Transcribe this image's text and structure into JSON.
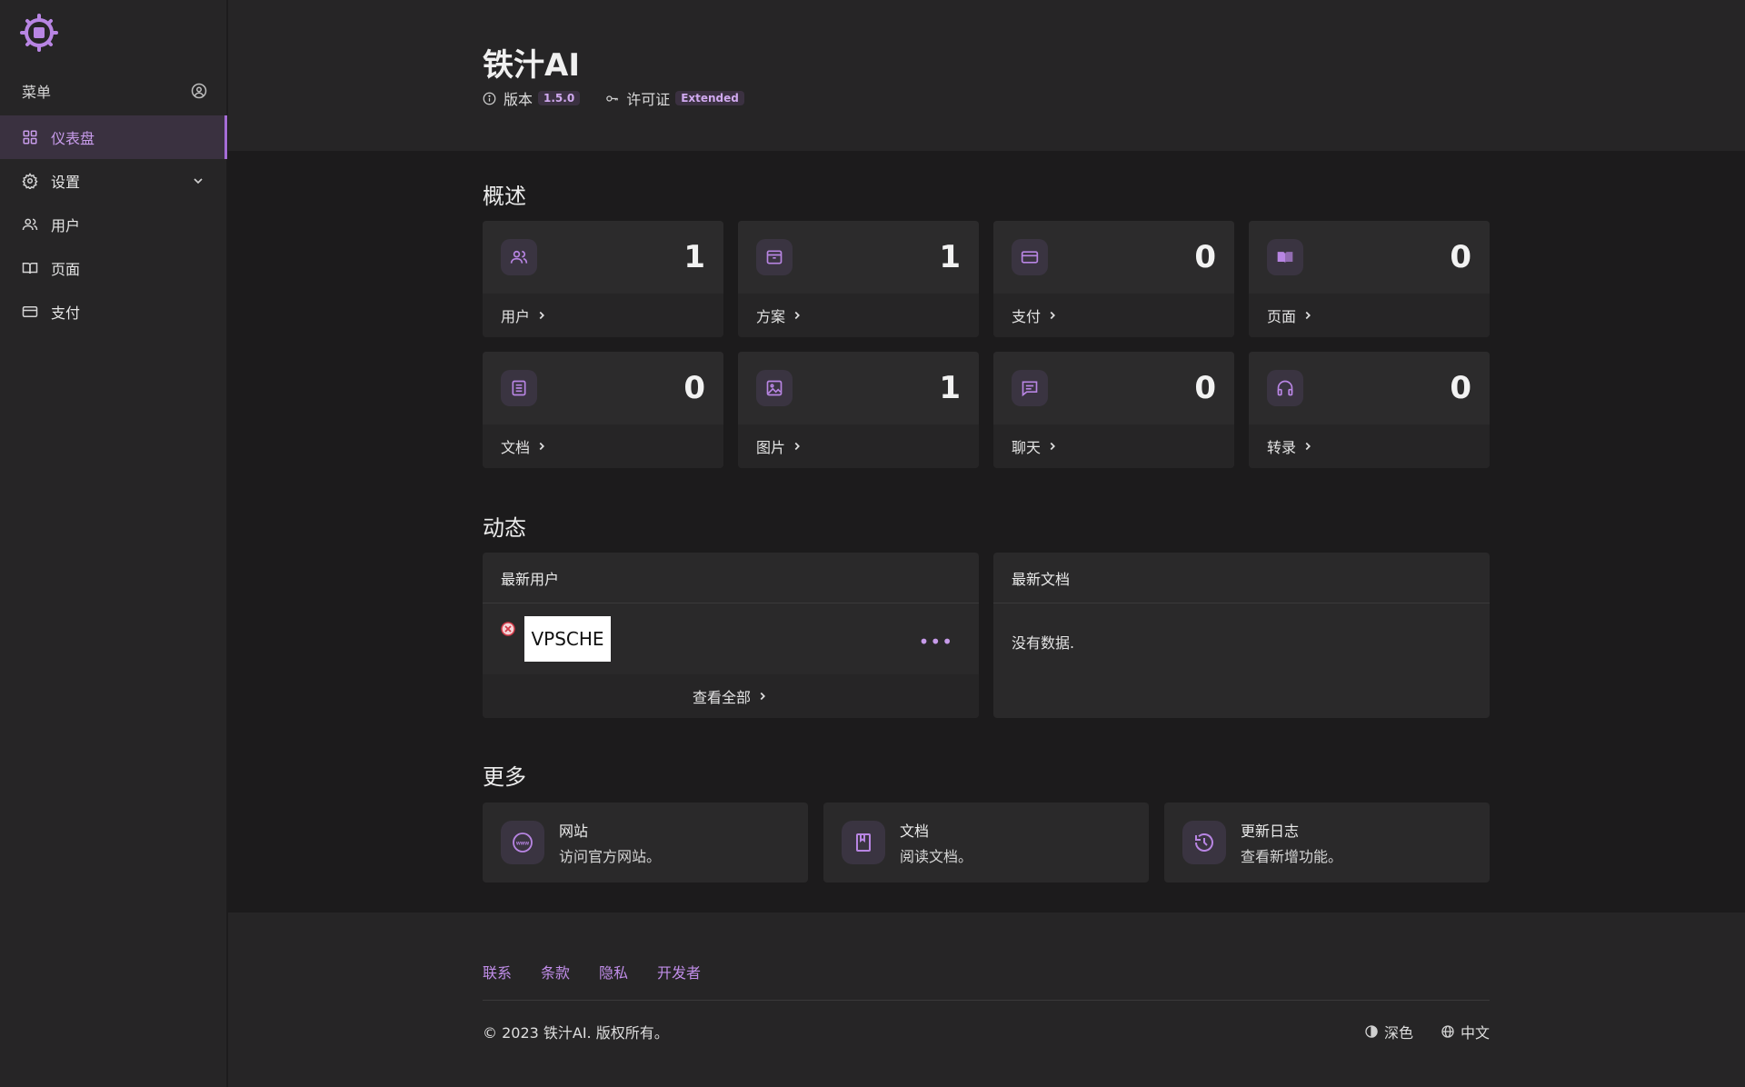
{
  "sidebar": {
    "menu_label": "菜单",
    "items": [
      {
        "label": "仪表盘",
        "icon": "grid-icon"
      },
      {
        "label": "设置",
        "icon": "gear-icon"
      },
      {
        "label": "用户",
        "icon": "users-icon"
      },
      {
        "label": "页面",
        "icon": "book-icon"
      },
      {
        "label": "支付",
        "icon": "card-icon"
      }
    ]
  },
  "header": {
    "title": "铁汁AI",
    "version_label": "版本",
    "version": "1.5.0",
    "license_label": "许可证",
    "license": "Extended"
  },
  "overview": {
    "title": "概述",
    "cards": [
      {
        "label": "用户",
        "value": "1"
      },
      {
        "label": "方案",
        "value": "1"
      },
      {
        "label": "支付",
        "value": "0"
      },
      {
        "label": "页面",
        "value": "0"
      },
      {
        "label": "文档",
        "value": "0"
      },
      {
        "label": "图片",
        "value": "1"
      },
      {
        "label": "聊天",
        "value": "0"
      },
      {
        "label": "转录",
        "value": "0"
      }
    ]
  },
  "activity": {
    "title": "动态",
    "latest_users": {
      "title": "最新用户",
      "user_image_text": "VPSCHE",
      "view_all": "查看全部"
    },
    "latest_documents": {
      "title": "最新文档",
      "empty": "没有数据."
    }
  },
  "more": {
    "title": "更多",
    "cards": [
      {
        "title": "网站",
        "desc": "访问官方网站。"
      },
      {
        "title": "文档",
        "desc": "阅读文档。"
      },
      {
        "title": "更新日志",
        "desc": "查看新增功能。"
      }
    ]
  },
  "footer": {
    "links": [
      "联系",
      "条款",
      "隐私",
      "开发者"
    ],
    "copyright": "© 2023 铁汁AI. 版权所有。",
    "theme": "深色",
    "language": "中文"
  },
  "colors": {
    "accent": "#b885e3",
    "background": "#1c1b1c",
    "panel": "#2a292a"
  }
}
